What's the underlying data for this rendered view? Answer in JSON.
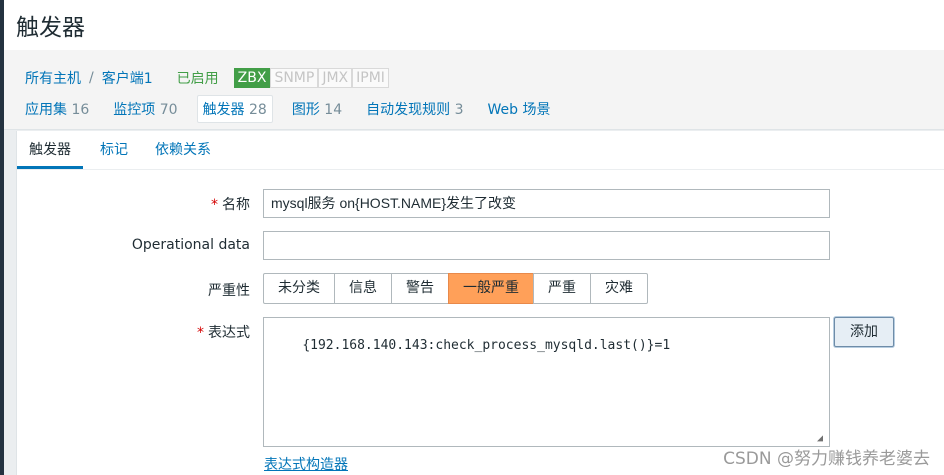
{
  "page": {
    "title": "触发器"
  },
  "host_nav": {
    "all_hosts": "所有主机",
    "separator": "/",
    "host_name": "客户端1",
    "status": "已启用",
    "availability": [
      "ZBX",
      "SNMP",
      "JMX",
      "IPMI"
    ],
    "tabs": [
      {
        "label": "应用集",
        "count": "16"
      },
      {
        "label": "监控项",
        "count": "70"
      },
      {
        "label": "触发器",
        "count": "28"
      },
      {
        "label": "图形",
        "count": "14"
      },
      {
        "label": "自动发现规则",
        "count": "3"
      },
      {
        "label": "Web 场景",
        "count": ""
      }
    ]
  },
  "subtabs": [
    "触发器",
    "标记",
    "依赖关系"
  ],
  "form": {
    "required_mark": "*",
    "name_label": "名称",
    "name_value": "mysql服务 on{HOST.NAME}发生了改变",
    "opdata_label": "Operational data",
    "opdata_value": "",
    "severity_label": "严重性",
    "severity_options": [
      "未分类",
      "信息",
      "警告",
      "一般严重",
      "严重",
      "灾难"
    ],
    "severity_selected": "一般严重",
    "expression_label": "表达式",
    "expression_value": "{192.168.140.143:check_process_mysqld.last()}=1",
    "add_button": "添加",
    "builder_link": "表达式构造器"
  },
  "watermark": "CSDN @努力赚钱养老婆去",
  "colors": {
    "accent": "#0275b8",
    "enabled": "#429e47",
    "selected_severity": "#ffa059",
    "required": "#d40000"
  }
}
